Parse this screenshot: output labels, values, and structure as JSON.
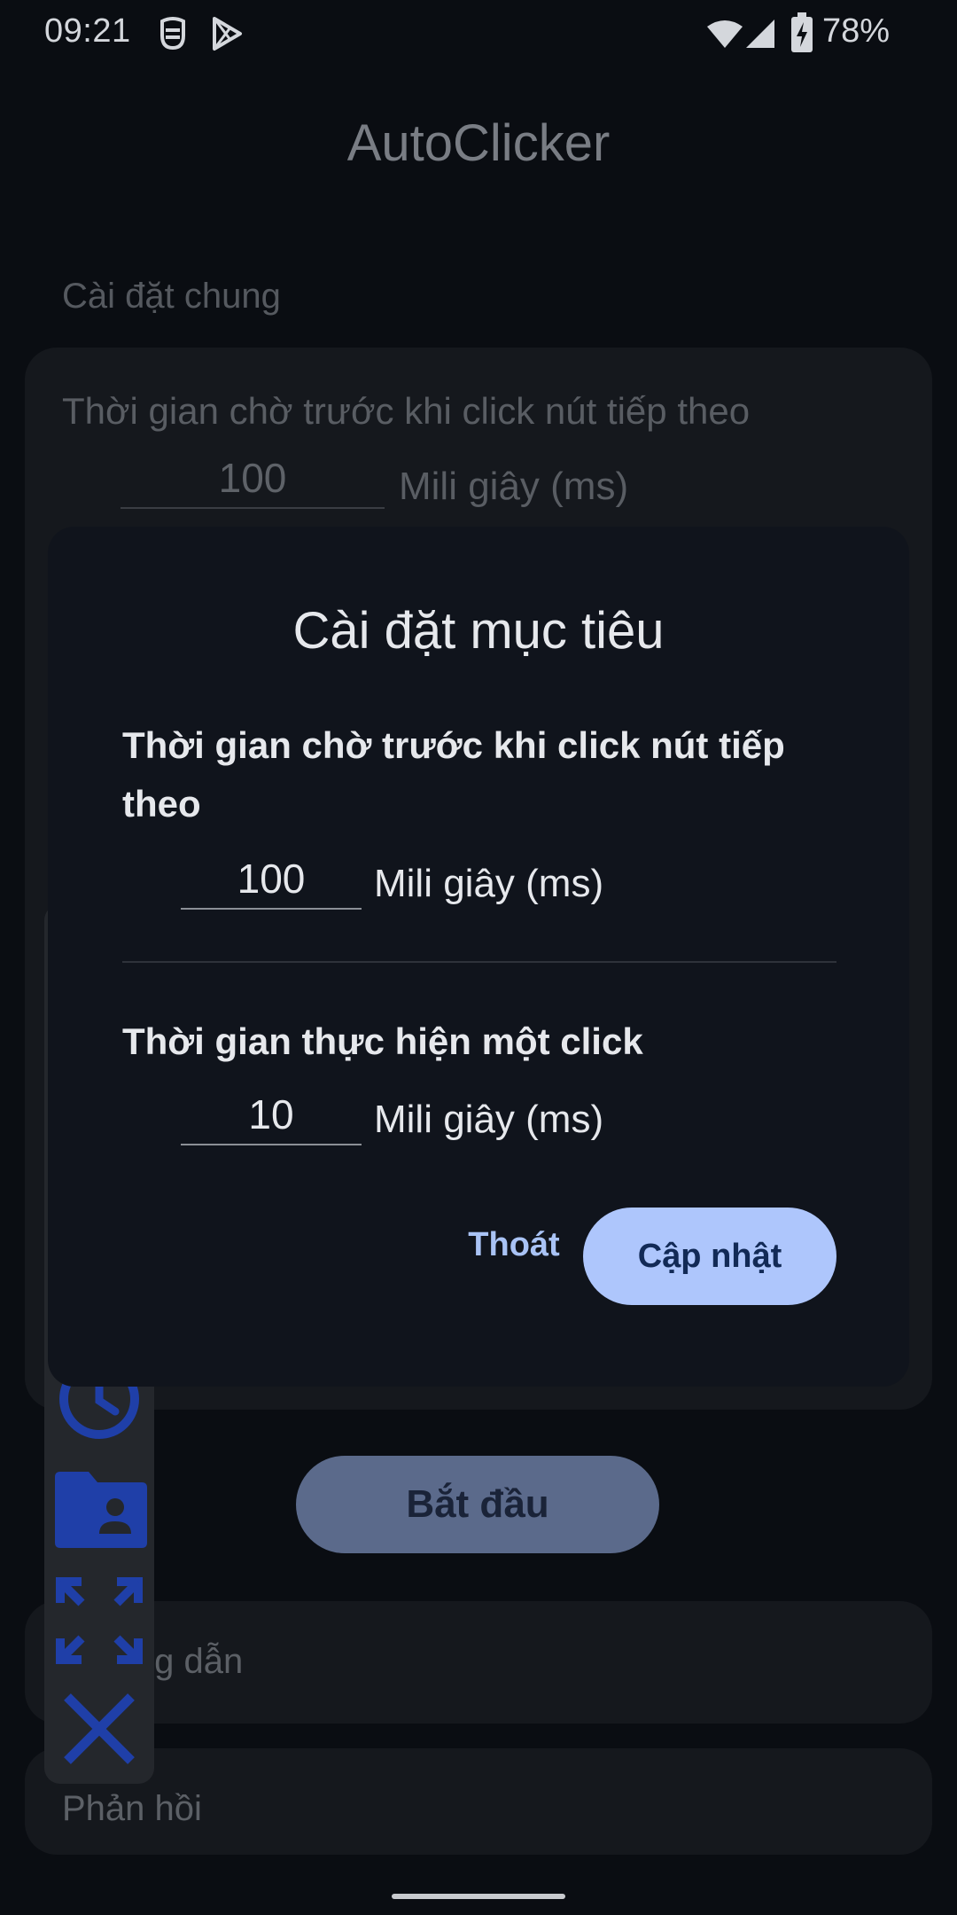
{
  "status_bar": {
    "time": "09:21",
    "battery_percent": "78%",
    "icons": [
      "face-mask-icon",
      "play-store-icon",
      "wifi-icon",
      "signal-icon",
      "battery-charging-icon"
    ]
  },
  "app": {
    "title": "AutoClicker",
    "section_general": "Cài đặt chung",
    "setting_delay_label": "Thời gian chờ trước khi click nút tiếp theo",
    "setting_delay_value": "100",
    "unit_ms": "Mili giây (ms)",
    "start_button": "Bắt đầu",
    "guide_label": "Hướng dẫn",
    "feedback_label": "Phản hồi"
  },
  "floating_toolbar": {
    "icons": [
      "timer-icon",
      "folder-person-icon",
      "expand-arrows-icon",
      "close-icon"
    ],
    "accent": "#1f3fa8"
  },
  "dialog": {
    "title": "Cài đặt mục tiêu",
    "delay_label": "Thời gian chờ trước khi click nút tiếp theo",
    "delay_value": "100",
    "click_duration_label": "Thời gian thực hiện một click",
    "click_duration_value": "10",
    "unit": "Mili giây (ms)",
    "cancel_button": "Thoát",
    "update_button": "Cập nhật"
  },
  "colors": {
    "background": "#0a0d12",
    "dialog_bg": "#10141c",
    "primary_button": "#aec6fc",
    "text_button": "#a9c3f5"
  }
}
